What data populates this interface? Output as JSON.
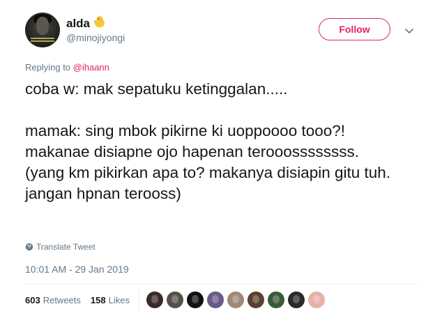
{
  "author": {
    "display_name": "alda",
    "emoji": "chick-emoji",
    "handle": "@minojiyongi"
  },
  "follow_label": "Follow",
  "replying": {
    "prefix": "Replying to ",
    "mention": "@ihaann"
  },
  "tweet_text": "coba w: mak sepatuku ketinggalan.....\n\nmamak: sing mbok pikirne ki uoppoooo tooo?! makanae disiapne ojo hapenan terooossssssss. (yang km pikirkan apa to? makanya disiapin gitu tuh. jangan hpnan terooss)",
  "translate_label": "Translate Tweet",
  "timestamp": "10:01 AM - 29 Jan 2019",
  "stats": {
    "retweets_count": "603",
    "retweets_label": "Retweets",
    "likes_count": "158",
    "likes_label": "Likes"
  },
  "liker_colors": [
    "#3b2a2a",
    "#55504a",
    "#111111",
    "#6a5a8a",
    "#a08878",
    "#5a4030",
    "#3a5a3a",
    "#2a2a2a",
    "#e8b0a8"
  ],
  "colors": {
    "accent": "#e0245e",
    "secondary_text": "#657786",
    "primary_text": "#14171a"
  }
}
